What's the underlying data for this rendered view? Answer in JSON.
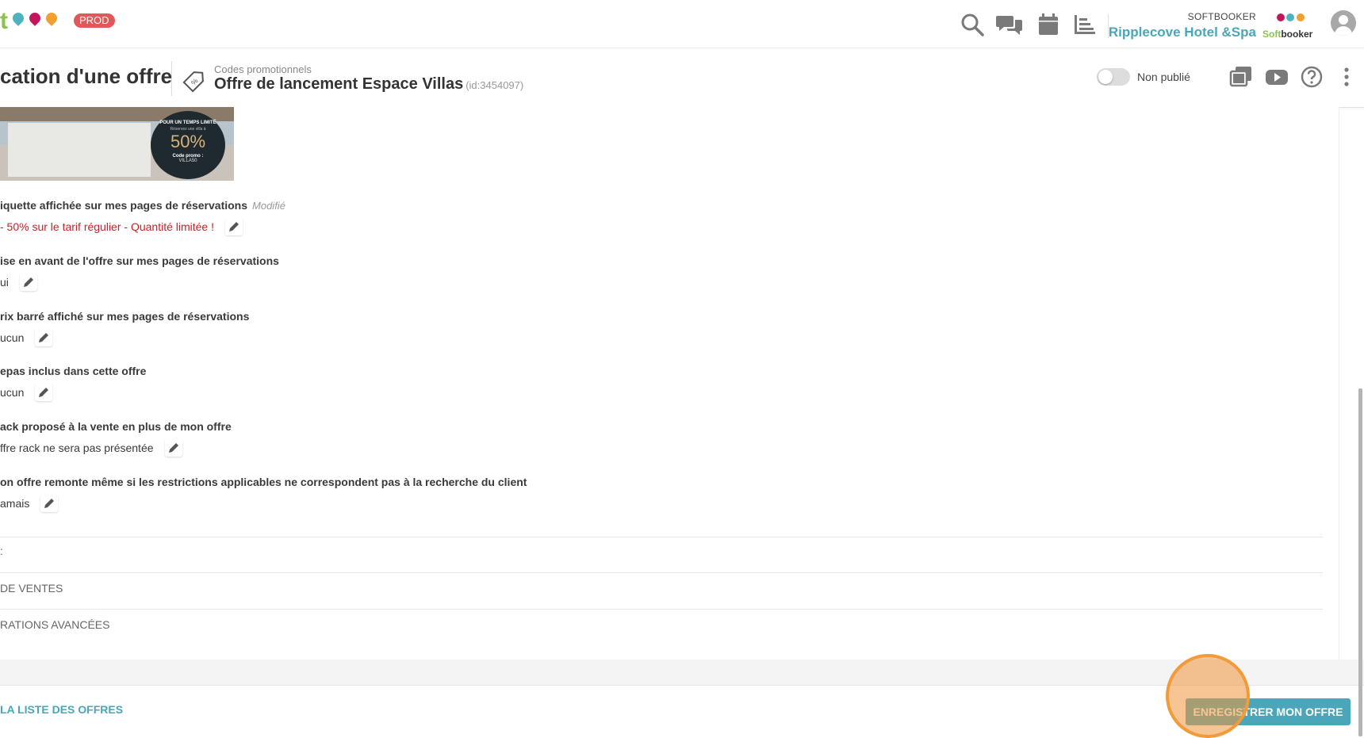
{
  "app": {
    "logo_letter": "t",
    "env_badge": "PROD",
    "account_label": "SOFTBOOKER",
    "hotel_name": "Ripplecove Hotel &Spa",
    "brand_soft": "Soft",
    "brand_booker": "booker"
  },
  "toolbar_icons": [
    "search-icon",
    "chat-icon",
    "calendar-icon",
    "list-icon"
  ],
  "header": {
    "page_title": "cation d'une offre",
    "breadcrumb": "Codes promotionnels",
    "offer_title": "Offre de lancement Espace Villas",
    "offer_id": "(id:3454097)",
    "publish_label": "Non publié",
    "published": false
  },
  "image_badge": {
    "line1": "POUR UN TEMPS LIMITÉ",
    "line2": "Réservez une villa à",
    "percent": "50%",
    "line3": "Code promo :",
    "code": "VILLA50"
  },
  "fields": [
    {
      "label": "iquette affichée sur mes pages de réservations",
      "modified": "Modifié",
      "value": "- 50% sur le tarif régulier - Quantité limitée !"
    },
    {
      "label": "ise en avant de l'offre sur mes pages de réservations",
      "value": "ui"
    },
    {
      "label": "rix barré affiché sur mes pages de réservations",
      "value": "ucun"
    },
    {
      "label": "epas inclus dans cette offre",
      "value": "ucun"
    },
    {
      "label": "ack proposé à la vente en plus de mon offre",
      "value": "ffre rack ne sera pas présentée"
    },
    {
      "label": "on offre remonte même si les restrictions applicables ne correspondent pas à la recherche du client",
      "value": "amais"
    }
  ],
  "sections": [
    ":",
    "DE VENTES",
    "RATIONS AVANCÉES"
  ],
  "footer": {
    "back_link": "LA LISTE DES OFFRES",
    "save_button": "ENREGISTRER MON OFFRE"
  },
  "colors": {
    "accent": "#4aa6b8",
    "prod_badge": "#e05858",
    "label_red": "#c0242a",
    "click_highlight": "#f39a3a"
  }
}
